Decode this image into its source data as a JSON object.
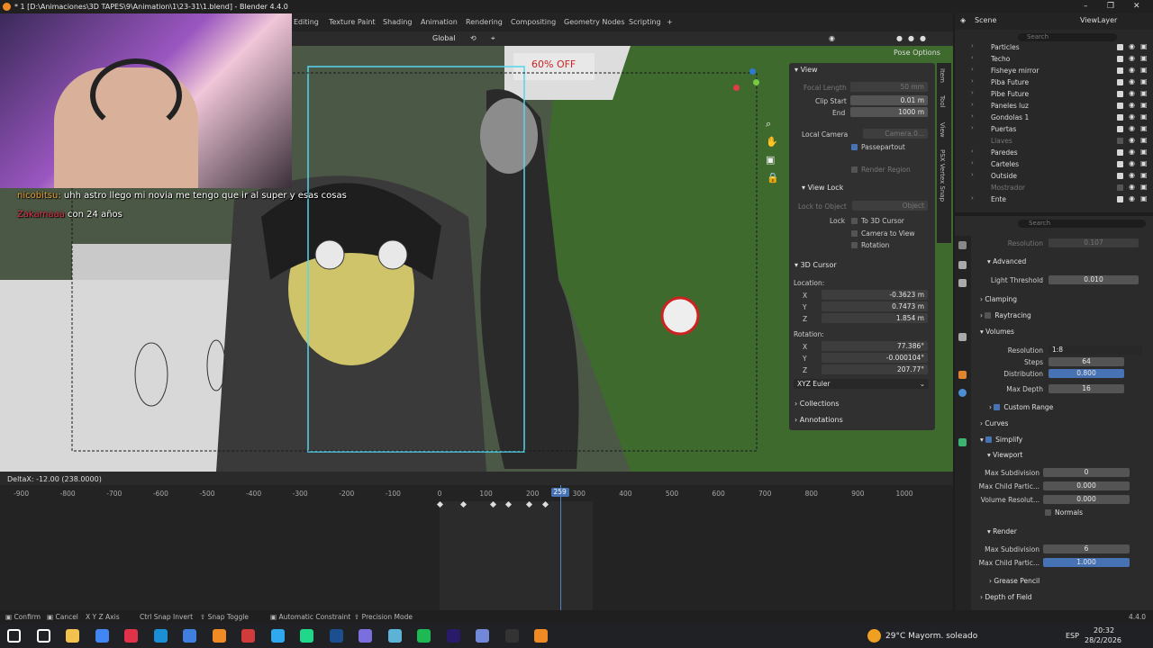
{
  "window": {
    "title": "* 1 [D:\\Animaciones\\3D TAPES\\9\\Animation\\1\\23-31\\1.blend] - Blender 4.4.0",
    "controls": [
      "–",
      "❐",
      "✕"
    ]
  },
  "workspaces": [
    "Editing",
    "Texture Paint",
    "Shading",
    "Animation",
    "Rendering",
    "Compositing",
    "Geometry Nodes",
    "Scripting",
    "+"
  ],
  "scene": {
    "label": "Scene",
    "view_layer": "ViewLayer"
  },
  "viewport_header": {
    "orientation": "Global",
    "pose_options": "Pose Options"
  },
  "chat": [
    {
      "user": "nicobitsu:",
      "user_color": "#e8a33c",
      "text": "uhh astro llego mi novia me tengo que ir al super y esas cosas"
    },
    {
      "user": "Zakamaaa",
      "user_color": "#e0334a",
      "text": "con 24 años"
    }
  ],
  "n_panel": {
    "view_title": "View",
    "focal_length": {
      "label": "Focal Length",
      "value": "50 mm"
    },
    "clip_start": {
      "label": "Clip Start",
      "value": "0.01 m"
    },
    "clip_end": {
      "label": "End",
      "value": "1000 m"
    },
    "local_camera": {
      "label": "Local Camera",
      "value": "Camera.0..."
    },
    "passepartout": "Passepartout",
    "render_region": "Render Region",
    "view_lock_title": "View Lock",
    "lock_to_object": {
      "label": "Lock to Object",
      "value": "Object"
    },
    "lock": {
      "label": "Lock",
      "options": [
        "To 3D Cursor",
        "Camera to View",
        "Rotation"
      ]
    },
    "cursor_title": "3D Cursor",
    "location_label": "Location:",
    "location": [
      {
        "axis": "X",
        "value": "-0.3623 m"
      },
      {
        "axis": "Y",
        "value": "0.7473 m"
      },
      {
        "axis": "Z",
        "value": "1.854 m"
      }
    ],
    "rotation_label": "Rotation:",
    "rotation": [
      {
        "axis": "X",
        "value": "77.386°"
      },
      {
        "axis": "Y",
        "value": "-0.000104°"
      },
      {
        "axis": "Z",
        "value": "207.77°"
      }
    ],
    "rotation_mode": "XYZ Euler",
    "collections": "Collections",
    "annotations": "Annotations",
    "tabs": [
      "Item",
      "Tool",
      "View",
      "PSX Vertex Snap"
    ]
  },
  "outliner": {
    "search_placeholder": "Search",
    "items": [
      {
        "name": "Particles",
        "dim": false
      },
      {
        "name": "Techo",
        "dim": false
      },
      {
        "name": "Fisheye mirror",
        "dim": false
      },
      {
        "name": "Piba Future",
        "dim": false
      },
      {
        "name": "Pibe Future",
        "dim": false
      },
      {
        "name": "Paneles luz",
        "dim": false
      },
      {
        "name": "Gondolas 1",
        "dim": false
      },
      {
        "name": "Puertas",
        "dim": false
      },
      {
        "name": "Llaves",
        "dim": true
      },
      {
        "name": "Paredes",
        "dim": false
      },
      {
        "name": "Carteles",
        "dim": false
      },
      {
        "name": "Outside",
        "dim": false
      },
      {
        "name": "Mostrador",
        "dim": true
      },
      {
        "name": "Ente",
        "dim": false
      }
    ]
  },
  "properties": {
    "search_placeholder": "Search",
    "resolution_top": {
      "label": "Resolution",
      "value": "0.107"
    },
    "advanced": "Advanced",
    "light_threshold": {
      "label": "Light Threshold",
      "value": "0.010"
    },
    "clamping": "Clamping",
    "raytracing": "Raytracing",
    "volumes": "Volumes",
    "vol_resolution": {
      "label": "Resolution",
      "value": "1:8"
    },
    "steps": {
      "label": "Steps",
      "value": "64"
    },
    "distribution": {
      "label": "Distribution",
      "value": "0.800"
    },
    "max_depth": {
      "label": "Max Depth",
      "value": "16"
    },
    "custom_range": "Custom Range",
    "curves": "Curves",
    "simplify": "Simplify",
    "viewport": "Viewport",
    "vp_max_subdivision": {
      "label": "Max Subdivision",
      "value": "0"
    },
    "vp_max_child": {
      "label": "Max Child Partic...",
      "value": "0.000"
    },
    "vp_volume_res": {
      "label": "Volume Resolut...",
      "value": "0.000"
    },
    "normals": "Normals",
    "render": "Render",
    "r_max_subdivision": {
      "label": "Max Subdivision",
      "value": "6"
    },
    "r_max_child": {
      "label": "Max Child Partic...",
      "value": "1.000"
    },
    "grease_pencil": "Grease Pencil",
    "depth_of_field": "Depth of Field"
  },
  "status": {
    "delta": "DeltaX: -12.00 (238.0000)"
  },
  "timeline": {
    "ticks": [
      -900,
      -800,
      -700,
      -600,
      -500,
      -400,
      -300,
      -200,
      -100,
      0,
      100,
      200,
      300,
      400,
      500,
      600,
      700,
      800,
      900,
      1000
    ],
    "current_frame": "259",
    "keyframes": [
      0,
      50,
      115,
      148,
      192,
      226
    ]
  },
  "footer": {
    "items": [
      "Confirm",
      "Cancel",
      "Axis",
      "Snap Invert",
      "Snap Toggle",
      "Automatic Constraint",
      "Precision Mode"
    ],
    "axis_keys": [
      "X",
      "Y",
      "Z"
    ],
    "snap_key": "Ctrl",
    "version": "4.4.0"
  },
  "taskbar": {
    "weather": "29°C  Mayorm. soleado",
    "lang": "ESP",
    "time": "20:32",
    "date": "28/2/2026",
    "icons": [
      "start-icon",
      "search-icon",
      "file-explorer-icon",
      "chrome-icon",
      "opera-icon",
      "edge-icon",
      "app-icon",
      "blender-icon",
      "recorder-icon",
      "photoshop-icon",
      "pycharm-icon",
      "vscode-icon",
      "app2-icon",
      "app3-icon",
      "spotify-icon",
      "after-effects-icon",
      "discord-icon",
      "obs-icon",
      "blender-active-icon"
    ]
  }
}
